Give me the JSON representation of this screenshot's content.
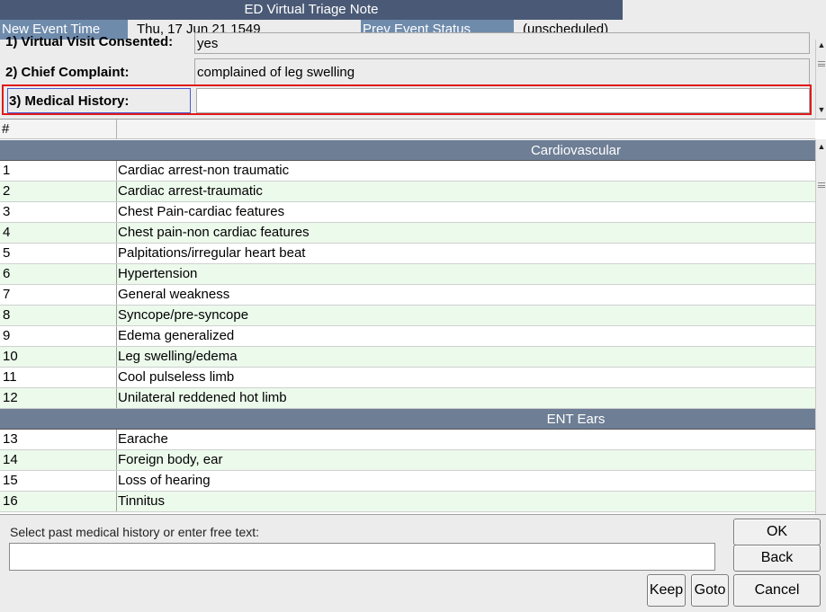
{
  "window": {
    "title": "ED Virtual Triage Note"
  },
  "infobar": {
    "event_time_label": "New Event Time",
    "event_time_value": "Thu, 17 Jun 21  1549",
    "prev_status_label": "Prev Event Status",
    "prev_status_value": "(unscheduled)"
  },
  "questions": [
    {
      "label": "1)  Virtual Visit Consented:",
      "value": "yes"
    },
    {
      "label": "2)  Chief Complaint:",
      "value": "complained of leg swelling"
    },
    {
      "label": "3)  Medical History:",
      "value": ""
    }
  ],
  "table": {
    "col_number_header": "#",
    "col_text_header": "",
    "sections": [
      {
        "title": "Cardiovascular",
        "rows": [
          {
            "num": "1",
            "text": "Cardiac arrest-non traumatic"
          },
          {
            "num": "2",
            "text": "Cardiac arrest-traumatic"
          },
          {
            "num": "3",
            "text": "Chest Pain-cardiac features"
          },
          {
            "num": "4",
            "text": "Chest pain-non cardiac features"
          },
          {
            "num": "5",
            "text": "Palpitations/irregular heart beat"
          },
          {
            "num": "6",
            "text": "Hypertension"
          },
          {
            "num": "7",
            "text": "General weakness"
          },
          {
            "num": "8",
            "text": "Syncope/pre-syncope"
          },
          {
            "num": "9",
            "text": "Edema generalized"
          },
          {
            "num": "10",
            "text": "Leg swelling/edema"
          },
          {
            "num": "11",
            "text": "Cool pulseless limb"
          },
          {
            "num": "12",
            "text": "Unilateral reddened hot limb"
          }
        ]
      },
      {
        "title": "ENT Ears",
        "rows": [
          {
            "num": "13",
            "text": "Earache"
          },
          {
            "num": "14",
            "text": "Foreign body, ear"
          },
          {
            "num": "15",
            "text": "Loss of hearing"
          },
          {
            "num": "16",
            "text": "Tinnitus"
          }
        ]
      }
    ]
  },
  "footer": {
    "prompt": "Select past medical history or enter free text:",
    "free_text_value": "",
    "ok_label": "OK",
    "back_label": "Back",
    "keep_label": "Keep",
    "goto_label": "Goto",
    "cancel_label": "Cancel"
  },
  "colors": {
    "title_bg": "#4a5a76",
    "label_bg": "#6f8bac",
    "section_bg": "#6d7e95",
    "even_row_bg": "#ecfaec",
    "highlight_border": "#e01a1a"
  }
}
